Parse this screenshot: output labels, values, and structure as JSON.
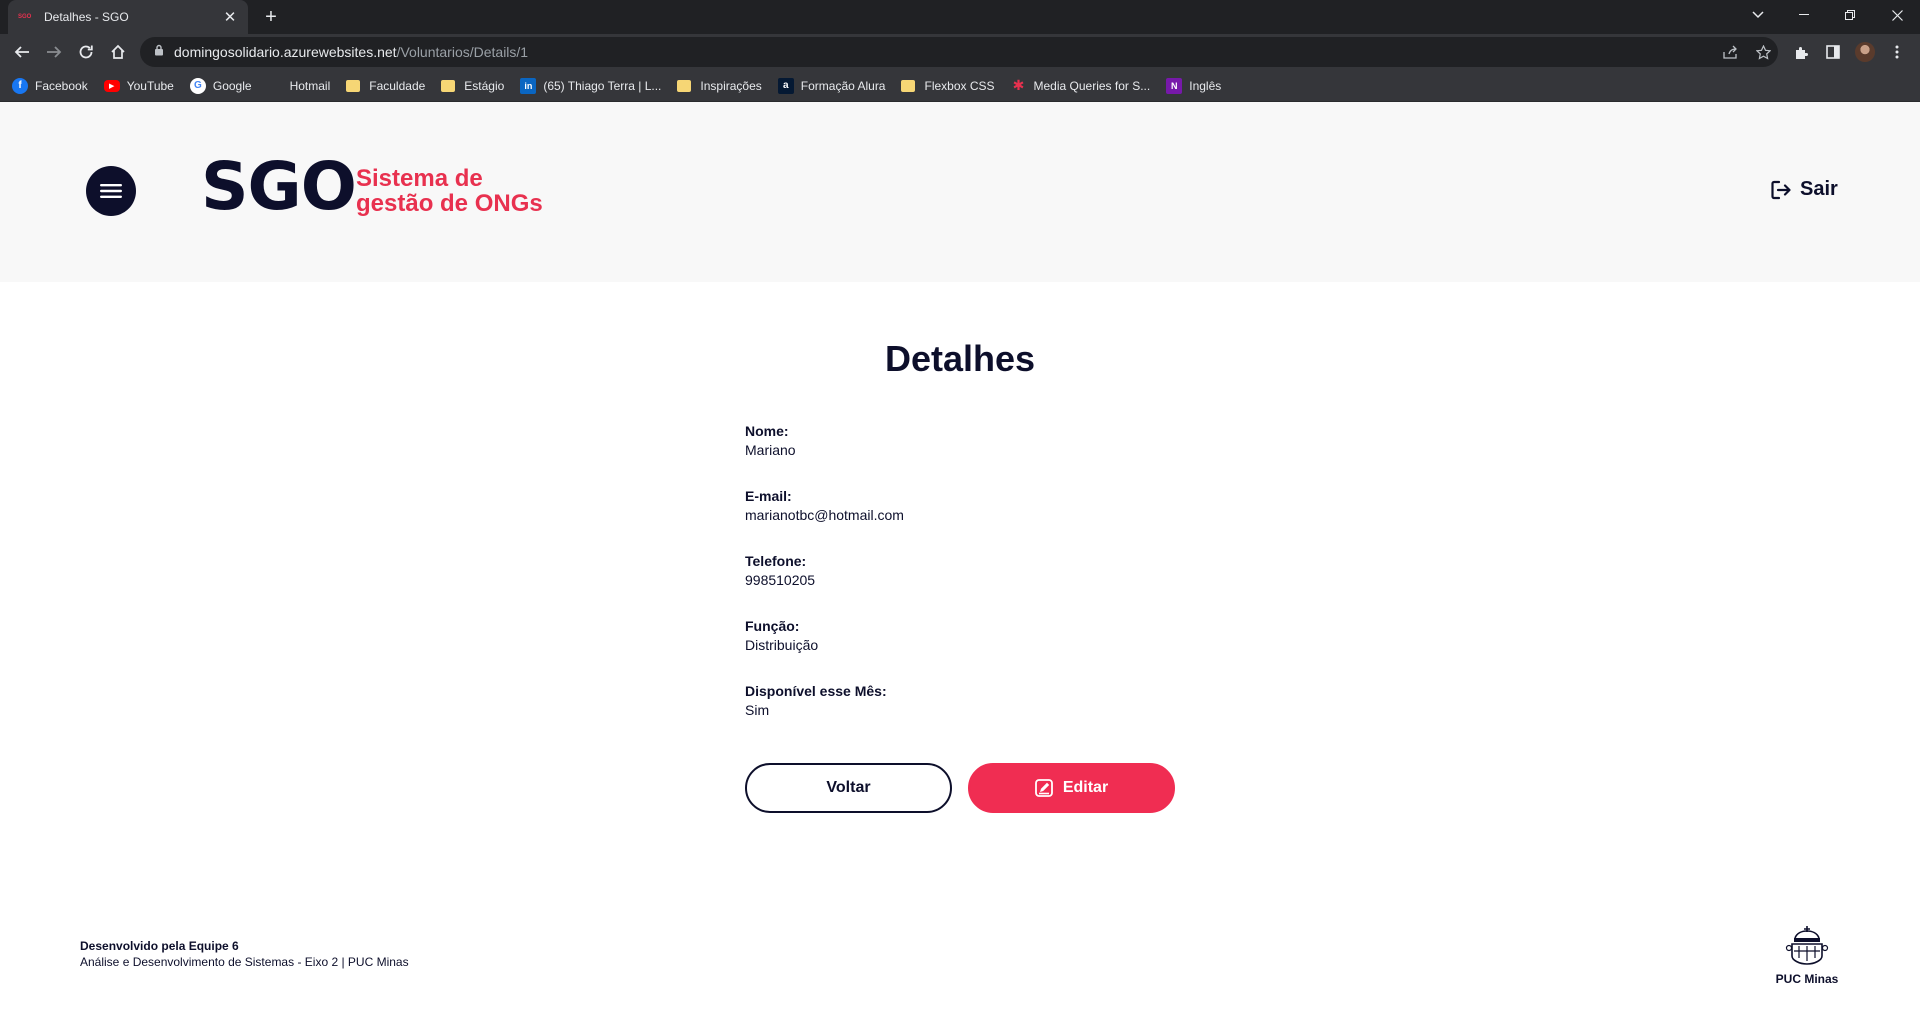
{
  "browser": {
    "tab_favicon": "SGO",
    "tab_title": "Detalhes - SGO",
    "new_tab": "+",
    "url_host": "domingosolidario.azurewebsites.net",
    "url_path": "/Voluntarios/Details/1",
    "bookmarks": [
      {
        "label": "Facebook",
        "icon": "facebook-icon",
        "color": "#1877f2",
        "glyph": "f"
      },
      {
        "label": "YouTube",
        "icon": "youtube-icon",
        "color": "#ff0000",
        "glyph": "▶"
      },
      {
        "label": "Google",
        "icon": "google-icon",
        "color": "#ffffff",
        "glyph": "G"
      },
      {
        "label": "Hotmail",
        "icon": "microsoft-icon",
        "color": "#f25022",
        "glyph": ""
      },
      {
        "label": "Faculdade",
        "icon": "folder-icon"
      },
      {
        "label": "Estágio",
        "icon": "folder-icon"
      },
      {
        "label": "(65) Thiago Terra | L...",
        "icon": "linkedin-icon",
        "color": "#0a66c2",
        "glyph": "in"
      },
      {
        "label": "Inspirações",
        "icon": "folder-icon"
      },
      {
        "label": "Formação Alura",
        "icon": "alura-icon",
        "color": "#051933",
        "glyph": "a"
      },
      {
        "label": "Flexbox CSS",
        "icon": "folder-icon"
      },
      {
        "label": "Media Queries for S...",
        "icon": "asterisk-icon",
        "color": "#e8314f",
        "glyph": "✱"
      },
      {
        "label": "Inglês",
        "icon": "onenote-icon",
        "color": "#7719aa",
        "glyph": "N"
      }
    ]
  },
  "header": {
    "logo": "SGO",
    "tagline": "Sistema de gestão de ONGs",
    "logout_label": "Sair"
  },
  "main": {
    "title": "Detalhes",
    "fields": [
      {
        "label": "Nome:",
        "value": "Mariano"
      },
      {
        "label": "E-mail:",
        "value": "marianotbc@hotmail.com"
      },
      {
        "label": "Telefone:",
        "value": "998510205"
      },
      {
        "label": "Função:",
        "value": "Distribuição"
      },
      {
        "label": "Disponível esse Mês:",
        "value": "Sim"
      }
    ],
    "back_label": "Voltar",
    "edit_label": "Editar"
  },
  "footer": {
    "team": "Desenvolvido pela Equipe 6",
    "course": "Análise e Desenvolvimento de Sistemas - Eixo 2 | PUC Minas",
    "institution": "PUC Minas"
  },
  "colors": {
    "navy": "#0d0f2b",
    "accent": "#f02d52",
    "header_bg": "#f8f8f8"
  }
}
